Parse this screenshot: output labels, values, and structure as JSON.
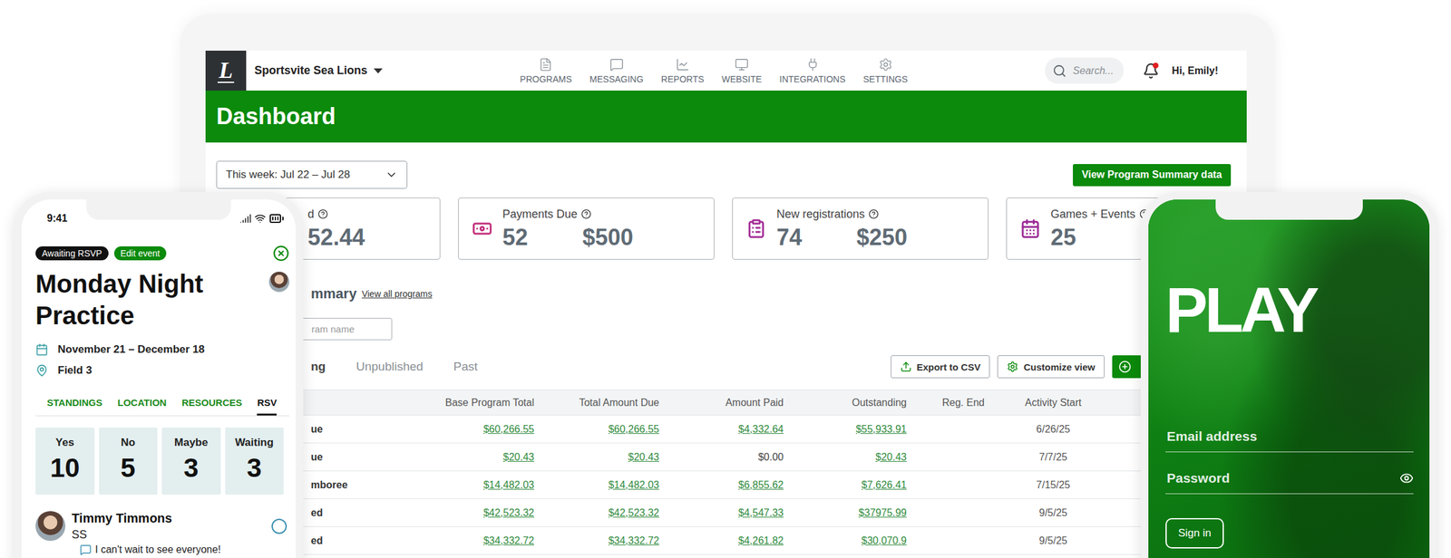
{
  "header": {
    "logo": "L",
    "org": "Sportsvite Sea Lions",
    "nav": [
      "PROGRAMS",
      "MESSAGING",
      "REPORTS",
      "WEBSITE",
      "INTEGRATIONS",
      "SETTINGS"
    ],
    "search": {
      "placeholder": "Search..."
    },
    "has_notification": true,
    "greeting": "Hi, Emily!"
  },
  "page_title": "Dashboard",
  "date_range": "This week: Jul 22 – Jul 28",
  "summary_button": "View Program Summary data",
  "cards": [
    {
      "label": "d",
      "values": [
        "52.44"
      ]
    },
    {
      "label": "Payments Due",
      "values": [
        "52",
        "$500"
      ],
      "color": "#c2307c"
    },
    {
      "label": "New registrations",
      "values": [
        "74",
        "$250"
      ],
      "color": "#a52f98"
    },
    {
      "label": "Games + Events",
      "values": [
        "25"
      ],
      "color": "#9b2c96"
    }
  ],
  "summary": {
    "title": "mmary",
    "link": "View all programs",
    "search_placeholder": "ram name",
    "tabs": [
      {
        "label": "ng",
        "selected": true
      },
      {
        "label": "Unpublished",
        "selected": false
      },
      {
        "label": "Past",
        "selected": false
      }
    ],
    "buttons": [
      "Export to CSV",
      "Customize view"
    ]
  },
  "table": {
    "columns": [
      "Base Program Total",
      "Total Amount Due",
      "Amount Paid",
      "Outstanding",
      "Reg. End",
      "Activity Start"
    ],
    "rows": [
      {
        "name": "ue",
        "amounts": [
          {
            "text": "$60,266.55",
            "link": true
          },
          {
            "text": "$60,266.55",
            "link": true
          },
          {
            "text": "$4,332.64",
            "link": true
          },
          {
            "text": "$55,933.91",
            "link": true
          }
        ],
        "activity_start": "6/26/25"
      },
      {
        "name": "ue",
        "amounts": [
          {
            "text": "$20.43",
            "link": true
          },
          {
            "text": "$20.43",
            "link": true
          },
          {
            "text": "$0.00",
            "link": false
          },
          {
            "text": "$20.43",
            "link": true
          }
        ],
        "activity_start": "7/7/25"
      },
      {
        "name": "mboree",
        "amounts": [
          {
            "text": "$14,482.03",
            "link": true
          },
          {
            "text": "$14,482.03",
            "link": true
          },
          {
            "text": "$6,855.62",
            "link": true
          },
          {
            "text": "$7,626.41",
            "link": true
          }
        ],
        "activity_start": "7/15/25"
      },
      {
        "name": "ed",
        "amounts": [
          {
            "text": "$42,523.32",
            "link": true
          },
          {
            "text": "$42,523.32",
            "link": true
          },
          {
            "text": "$4,547.33",
            "link": true
          },
          {
            "text": "$37975.99",
            "link": true
          }
        ],
        "activity_start": "9/5/25"
      },
      {
        "name": "ed",
        "amounts": [
          {
            "text": "$34,332.72",
            "link": true
          },
          {
            "text": "$34,332.72",
            "link": true
          },
          {
            "text": "$4,261.82",
            "link": true
          },
          {
            "text": "$30,070.9",
            "link": true
          }
        ],
        "activity_start": "9/5/25"
      }
    ]
  },
  "event_phone": {
    "time": "9:41",
    "badges": [
      {
        "label": "Awaiting RSVP",
        "color": "#111111"
      },
      {
        "label": "Edit event",
        "color": "#0b8a0b"
      }
    ],
    "title": "Monday Night Practice",
    "dates": "November 21 – December 18",
    "location": "Field 3",
    "tabs": [
      {
        "label": "STANDINGS",
        "selected": false
      },
      {
        "label": "LOCATION",
        "selected": false
      },
      {
        "label": "RESOURCES",
        "selected": false
      },
      {
        "label": "RSV",
        "selected": true
      }
    ],
    "rsvp": [
      {
        "label": "Yes",
        "count": "10"
      },
      {
        "label": "No",
        "count": "5"
      },
      {
        "label": "Maybe",
        "count": "3"
      },
      {
        "label": "Waiting",
        "count": "3"
      }
    ],
    "members": [
      {
        "name": "Timmy Timmons",
        "position": "SS",
        "comment": "I can't wait to see everyone!",
        "checked": false
      }
    ]
  },
  "login_phone": {
    "headline": "PLAY",
    "fields": [
      {
        "placeholder": "Email address",
        "kind": "text"
      },
      {
        "placeholder": "Password",
        "kind": "password"
      }
    ],
    "button": "Sign in"
  }
}
